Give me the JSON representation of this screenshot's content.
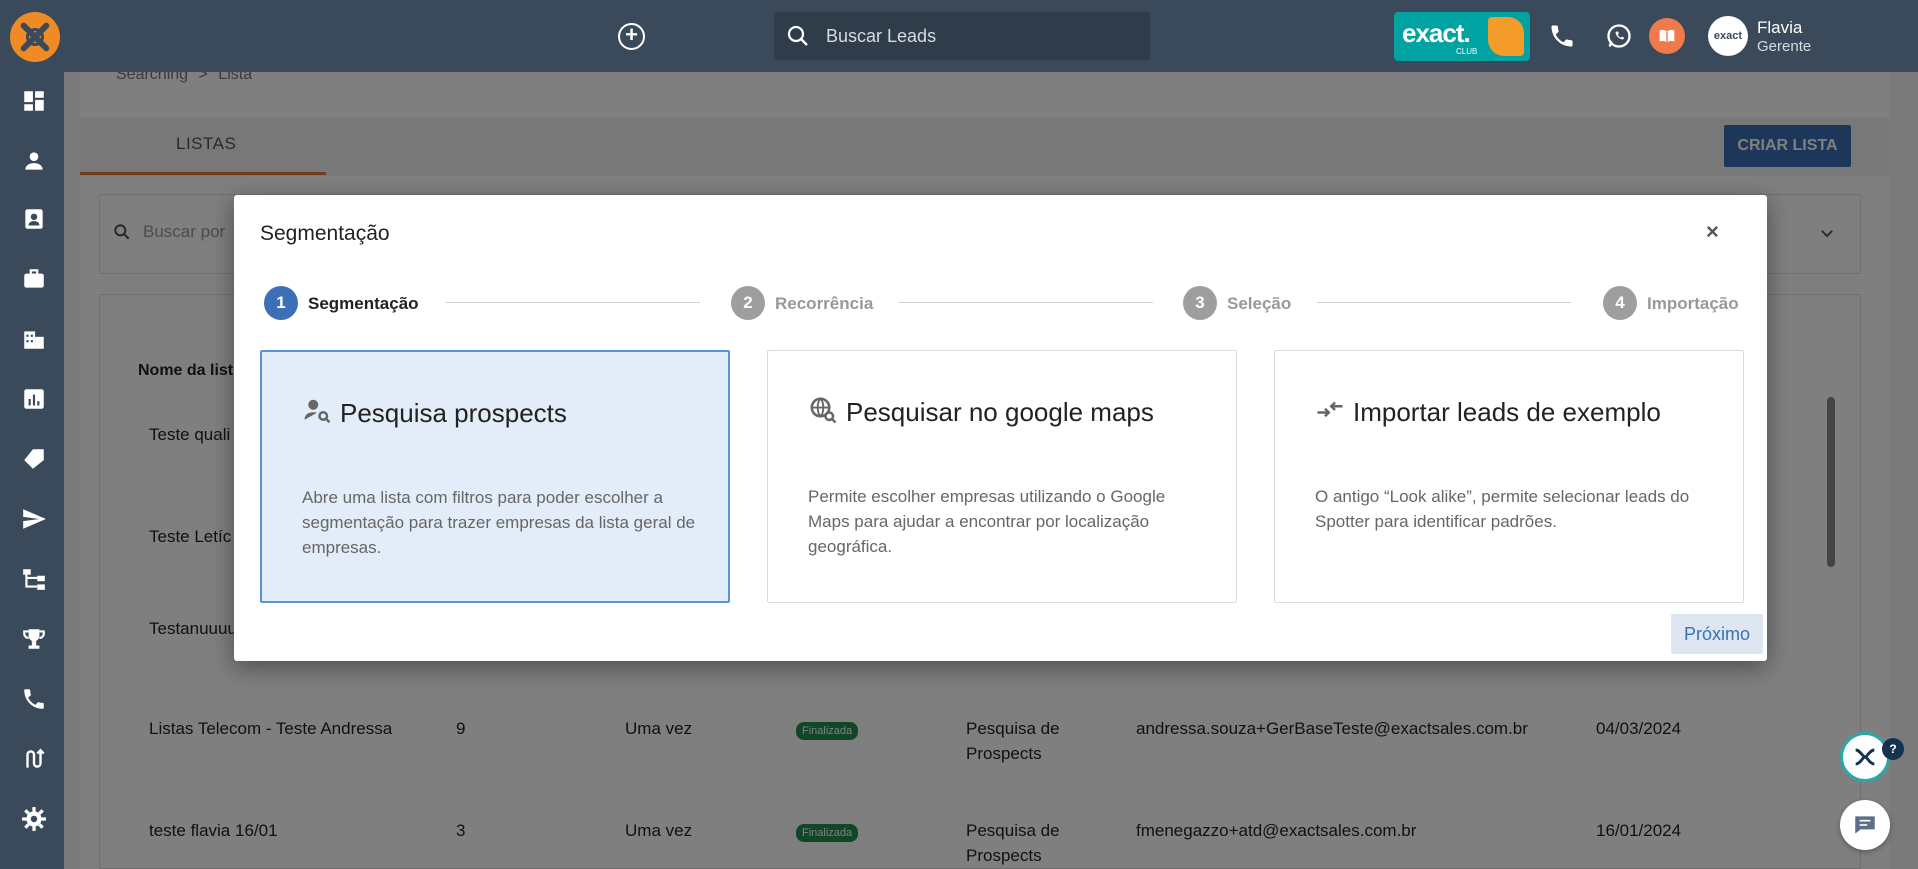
{
  "topbar": {
    "search_placeholder": "Buscar Leads",
    "brand": "exact.",
    "brand_sub": "CLUB",
    "avatar_text": "exact",
    "user_name": "Flavia",
    "user_role": "Gerente"
  },
  "sidebar": {
    "icons": [
      "dashboard-icon",
      "person-icon",
      "contact-card-icon",
      "briefcase-icon",
      "building-icon",
      "bar-chart-icon",
      "tag-icon",
      "send-icon",
      "hierarchy-icon",
      "trophy-icon",
      "phone-icon",
      "route-icon",
      "gear-icon"
    ]
  },
  "page": {
    "breadcrumb_root": "Searching",
    "breadcrumb_sep": ">",
    "breadcrumb_current": "Lista",
    "tab_label": "LISTAS",
    "create_button": "CRIAR LISTA",
    "filter_placeholder": "Buscar por",
    "column_header": "Nome da list",
    "rows": [
      {
        "name": "Teste quali"
      },
      {
        "name": "Teste Letíc"
      },
      {
        "name": "Testanuuuu"
      },
      {
        "name": "Listas Telecom - Teste Andressa",
        "count": "9",
        "frequency": "Uma vez",
        "status": "Finalizada",
        "type_line1": "Pesquisa de",
        "type_line2": "Prospects",
        "email": "andressa.souza+GerBaseTeste@exactsales.com.br",
        "date": "04/03/2024"
      },
      {
        "name": "teste flavia 16/01",
        "count": "3",
        "frequency": "Uma vez",
        "status": "Finalizada",
        "type_line1": "Pesquisa de",
        "type_line2": "Prospects",
        "email": "fmenegazzo+atd@exactsales.com.br",
        "date": "16/01/2024"
      }
    ]
  },
  "modal": {
    "title": "Segmentação",
    "close": "×",
    "steps": [
      {
        "number": "1",
        "label": "Segmentação",
        "active": true
      },
      {
        "number": "2",
        "label": "Recorrência",
        "active": false
      },
      {
        "number": "3",
        "label": "Seleção",
        "active": false
      },
      {
        "number": "4",
        "label": "Importação",
        "active": false
      }
    ],
    "options": [
      {
        "icon": "person-search-icon",
        "title": "Pesquisa prospects",
        "description": "Abre uma lista com filtros para poder escolher a segmentação para trazer empresas da lista geral de empresas.",
        "selected": true
      },
      {
        "icon": "globe-search-icon",
        "title": "Pesquisar no google maps",
        "description": "Permite escolher empresas utilizando o Google Maps para ajudar a encontrar por localização geográfica.",
        "selected": false
      },
      {
        "icon": "import-arrows-icon",
        "title": "Importar leads de exemplo",
        "description": "O antigo “Look alike”, permite selecionar leads do Spotter para identificar padrões.",
        "selected": false
      }
    ],
    "next_button": "Próximo"
  },
  "floating": {
    "help_badge": "?"
  },
  "colors": {
    "topbar": "#3b4a5a",
    "accent": "#3b6fb6",
    "brand_teal": "#00a2a2",
    "brand_orange": "#f08a24",
    "status_green": "#1e8f4e"
  }
}
